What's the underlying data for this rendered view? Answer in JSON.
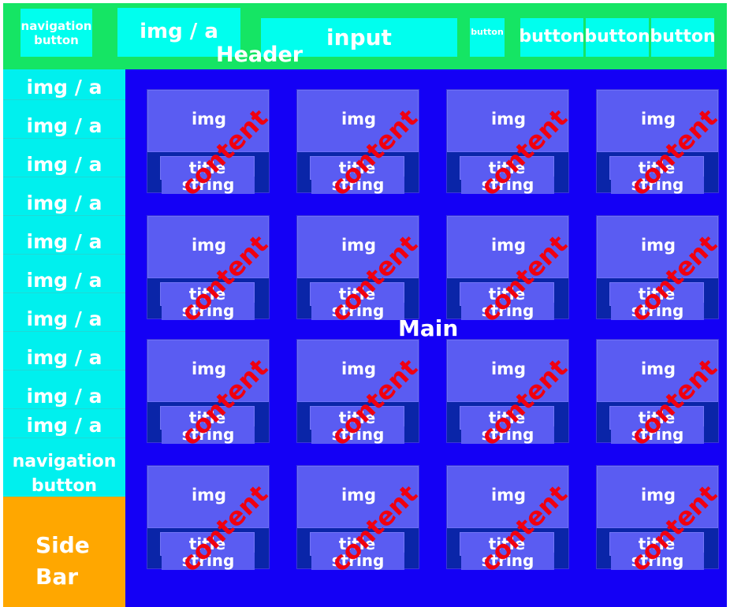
{
  "header": {
    "label": "Header",
    "nav_button": "navigation button",
    "logo": "img / a",
    "search": "input",
    "small_button": "button",
    "buttons": [
      "button",
      "button",
      "button"
    ]
  },
  "sidebar": {
    "items": [
      "img / a",
      "img / a",
      "img / a",
      "img / a",
      "img / a",
      "img / a",
      "img / a",
      "img / a",
      "img / a",
      "img / a"
    ],
    "nav_button": "navigation button",
    "footer_label": "Side Bar"
  },
  "main": {
    "label": "Main",
    "card": {
      "img": "img",
      "title": "title",
      "string": "string",
      "content": "content"
    }
  },
  "colors": {
    "header": "#15e564",
    "box": "#00ffee",
    "main": "#1400f5",
    "card": "#5a5cf2",
    "card_dark": "#0a25a8",
    "content": "#f00010",
    "sidebar_footer": "#ffa700"
  }
}
